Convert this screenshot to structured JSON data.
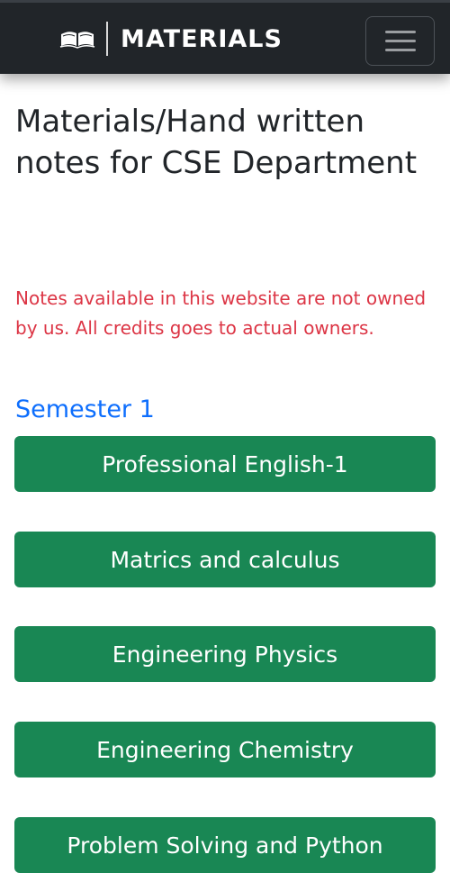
{
  "navbar": {
    "brand_icon": "open-book-icon",
    "brand_text": "MATERIALS",
    "toggler_icon": "hamburger-menu-icon",
    "background": "#212529"
  },
  "page": {
    "title": "Materials/Hand written notes for CSE Department",
    "disclaimer": "Notes available in this website are not owned by us. All credits goes to actual owners.",
    "disclaimer_color": "#dc3545"
  },
  "semester": {
    "heading": "Semester 1",
    "heading_color": "#0d6efd",
    "button_color": "#198754",
    "subjects": [
      "Professional English-1",
      "Matrics and calculus",
      "Engineering Physics",
      "Engineering Chemistry",
      "Problem Solving and Python"
    ]
  }
}
